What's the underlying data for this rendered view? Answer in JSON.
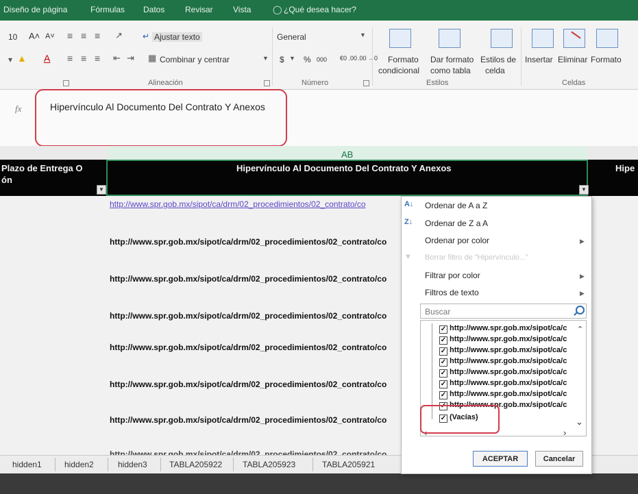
{
  "ribbon_tabs": [
    "Diseño de página",
    "Fórmulas",
    "Datos",
    "Revisar",
    "Vista",
    "¿Qué desea hacer?"
  ],
  "ribbon": {
    "font_size": "10",
    "wrap_text": "Ajustar texto",
    "merge_center": "Combinar y centrar",
    "number_format": "General",
    "currency": "$",
    "percent": "%",
    "thousands": "000",
    "dec_inc": "€0 .00",
    "dec_dec": ".00 →0",
    "conditional_format": [
      "Formato",
      "condicional"
    ],
    "format_table": [
      "Dar formato",
      "como tabla"
    ],
    "cell_styles": [
      "Estilos de",
      "celda"
    ],
    "insert": "Insertar",
    "delete": "Eliminar",
    "format": "Formato",
    "groups": {
      "alignment": "Alineación",
      "number": "Número",
      "styles": "Estilos",
      "cells": "Celdas"
    }
  },
  "formula_bar": {
    "fx": "fx",
    "content": "Hipervínculo Al Documento Del Contrato Y Anexos"
  },
  "sheet": {
    "col_letter": "AB",
    "left_header": [
      "Plazo de Entrega O",
      "ón"
    ],
    "main_header": "Hipervínculo Al Documento Del Contrato Y Anexos",
    "right_header": "Hipe",
    "rows": [
      "http://www.spr.gob.mx/sipot/ca/drm/02_procedimientos/02_contrato/co",
      "http://www.spr.gob.mx/sipot/ca/drm/02_procedimientos/02_contrato/co",
      "http://www.spr.gob.mx/sipot/ca/drm/02_procedimientos/02_contrato/co",
      "http://www.spr.gob.mx/sipot/ca/drm/02_procedimientos/02_contrato/co",
      "http://www.spr.gob.mx/sipot/ca/drm/02_procedimientos/02_contrato/co",
      "http://www.spr.gob.mx/sipot/ca/drm/02_procedimientos/02_contrato/co",
      "http://www.spr.gob.mx/sipot/ca/drm/02_procedimientos/02_contrato/co",
      "http://www.spr.gob.mx/sipot/ca/drm/02_procedimientos/02_contrato/co"
    ]
  },
  "sheet_tabs": [
    "hidden1",
    "hidden2",
    "hidden3",
    "TABLA205922",
    "TABLA205923",
    "TABLA205921"
  ],
  "filter_menu": {
    "sort_az": "Ordenar de A a Z",
    "sort_za": "Ordenar de Z a A",
    "sort_color": "Ordenar por color",
    "clear_filter": "Borrar filtro de \"Hipervínculo...\"",
    "filter_color": "Filtrar por color",
    "text_filters": "Filtros de texto",
    "search_placeholder": "Buscar",
    "items": [
      "http://www.spr.gob.mx/sipot/ca/c",
      "http://www.spr.gob.mx/sipot/ca/c",
      "http://www.spr.gob.mx/sipot/ca/c",
      "http://www.spr.gob.mx/sipot/ca/c",
      "http://www.spr.gob.mx/sipot/ca/c",
      "http://www.spr.gob.mx/sipot/ca/c",
      "http://www.spr.gob.mx/sipot/ca/c",
      "http://www.spr.gob.mx/sipot/ca/c"
    ],
    "blanks": "(Vacías)",
    "ok": "ACEPTAR",
    "cancel": "Cancelar"
  }
}
